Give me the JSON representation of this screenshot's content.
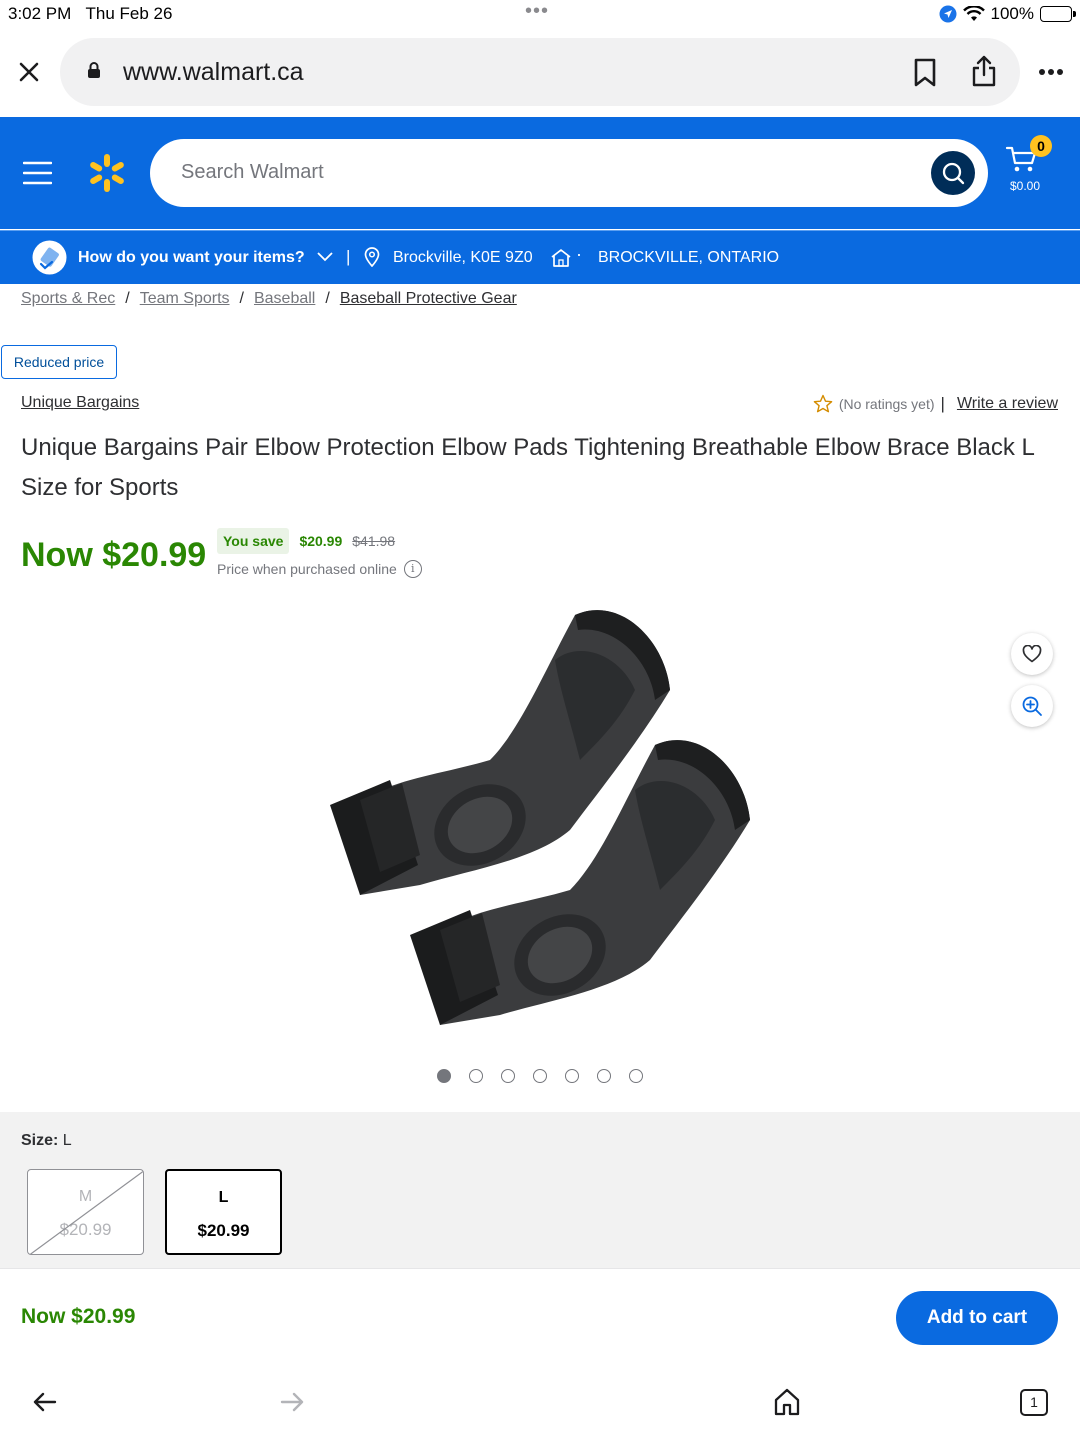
{
  "status_bar": {
    "time": "3:02 PM",
    "date": "Thu Feb 26",
    "battery": "100%"
  },
  "browser": {
    "url": "www.walmart.ca"
  },
  "header": {
    "search_placeholder": "Search Walmart",
    "cart_count": "0",
    "cart_total": "$0.00"
  },
  "delivery": {
    "question": "How do you want your items?",
    "location": "Brockville, K0E 9Z0",
    "store": "BROCKVILLE, ONTARIO"
  },
  "breadcrumb": [
    "Sports & Rec",
    "Team Sports",
    "Baseball",
    "Baseball Protective Gear"
  ],
  "product": {
    "badge": "Reduced price",
    "brand": "Unique Bargains",
    "ratings": "(No ratings yet)",
    "write_review": "Write a review",
    "title": "Unique Bargains Pair Elbow Protection Elbow Pads Tightening Breathable Elbow Brace Black L Size for Sports",
    "price_now": "Now $20.99",
    "you_save_label": "You save",
    "you_save_amount": "$20.99",
    "was_price": "$41.98",
    "price_note": "Price when purchased online",
    "image_count": 7,
    "image_index": 1
  },
  "size": {
    "label": "Size:",
    "selected": "L",
    "options": [
      {
        "size": "M",
        "price": "$20.99",
        "available": false
      },
      {
        "size": "L",
        "price": "$20.99",
        "available": true
      }
    ]
  },
  "footer": {
    "price_now": "Now $20.99",
    "add_to_cart": "Add to cart",
    "tab_count": "1"
  },
  "colors": {
    "brand_blue": "#0a6ae0",
    "spark_yellow": "#ffc220",
    "price_green": "#2a8703",
    "dark_navy": "#002d58"
  }
}
